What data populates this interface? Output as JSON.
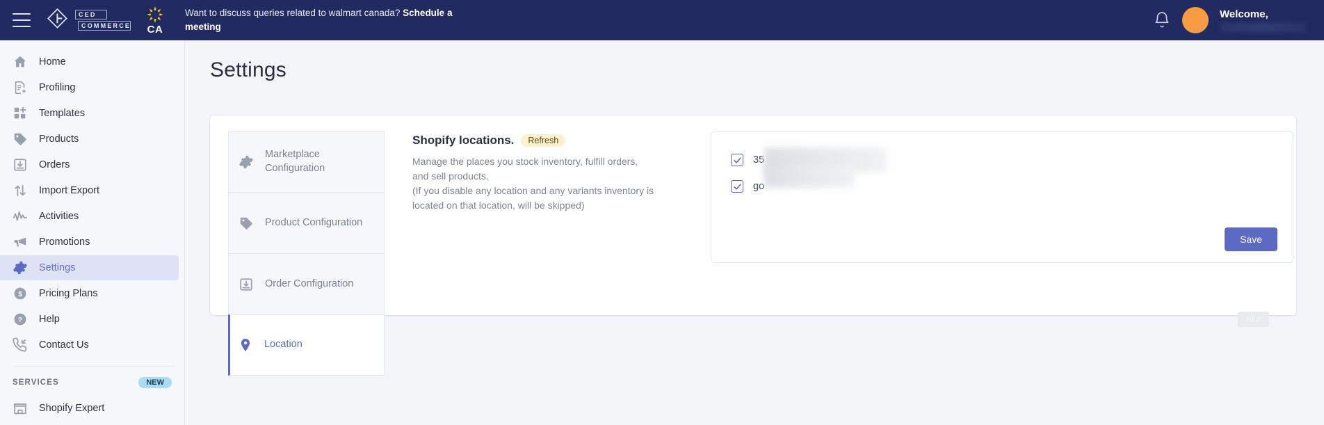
{
  "topbar": {
    "menu_icon": "hamburger-icon",
    "brand": {
      "line1": "CED",
      "line2": "COMMERCE"
    },
    "marketplace": {
      "icon": "walmart-spark-icon",
      "label": "CA"
    },
    "promo_text": "Want to discuss queries related to walmart canada? ",
    "promo_link": "Schedule a meeting",
    "notification_icon": "bell-icon",
    "avatar_icon": "avatar",
    "welcome_label": "Welcome,",
    "welcome_name_redacted": ""
  },
  "sidebar": {
    "items": [
      {
        "label": "Home",
        "icon": "home-icon",
        "active": false
      },
      {
        "label": "Profiling",
        "icon": "profiling-icon",
        "active": false
      },
      {
        "label": "Templates",
        "icon": "templates-icon",
        "active": false
      },
      {
        "label": "Products",
        "icon": "tag-icon",
        "active": false
      },
      {
        "label": "Orders",
        "icon": "orders-inbox-icon",
        "active": false
      },
      {
        "label": "Import Export",
        "icon": "arrows-up-down-icon",
        "active": false
      },
      {
        "label": "Activities",
        "icon": "activity-pulse-icon",
        "active": false
      },
      {
        "label": "Promotions",
        "icon": "megaphone-icon",
        "active": false
      },
      {
        "label": "Settings",
        "icon": "gear-icon",
        "active": true
      },
      {
        "label": "Pricing Plans",
        "icon": "dollar-circle-icon",
        "active": false
      },
      {
        "label": "Help",
        "icon": "question-circle-icon",
        "active": false
      },
      {
        "label": "Contact Us",
        "icon": "phone-incoming-icon",
        "active": false
      }
    ],
    "services": {
      "title": "SERVICES",
      "badge": "NEW",
      "items": [
        {
          "label": "Shopify Expert",
          "icon": "store-icon"
        }
      ]
    }
  },
  "main": {
    "page_title": "Settings",
    "tabs": [
      {
        "label": "Marketplace Configuration",
        "icon": "gear-icon",
        "active": false
      },
      {
        "label": "Product Configuration",
        "icon": "tag-icon",
        "active": false
      },
      {
        "label": "Order Configuration",
        "icon": "orders-inbox-icon",
        "active": false
      },
      {
        "label": "Location",
        "icon": "map-pin-icon",
        "active": true
      }
    ],
    "location": {
      "title": "Shopify locations.",
      "refresh_label": "Refresh",
      "description_line1": "Manage the places you stock inventory, fulfill orders,",
      "description_line2": "and sell products.",
      "description_line3": "(If you disable any location and any variants inventory is",
      "description_line4": "located on that location, will be skipped)",
      "checkboxes": [
        {
          "label": "35",
          "checked": true,
          "redacted": true
        },
        {
          "label": "go",
          "checked": true,
          "redacted": true
        }
      ],
      "save_label": "Save"
    },
    "blur_chip_label": "Blur"
  },
  "colors": {
    "topbar_bg": "#212b61",
    "accent_indigo": "#5c6ac4",
    "active_nav_bg": "#dfe1f5",
    "refresh_badge_bg": "#fcf1cd",
    "new_badge_bg": "#a8dcf7",
    "avatar_orange": "#f79c42",
    "page_bg": "#f4f5f8"
  }
}
